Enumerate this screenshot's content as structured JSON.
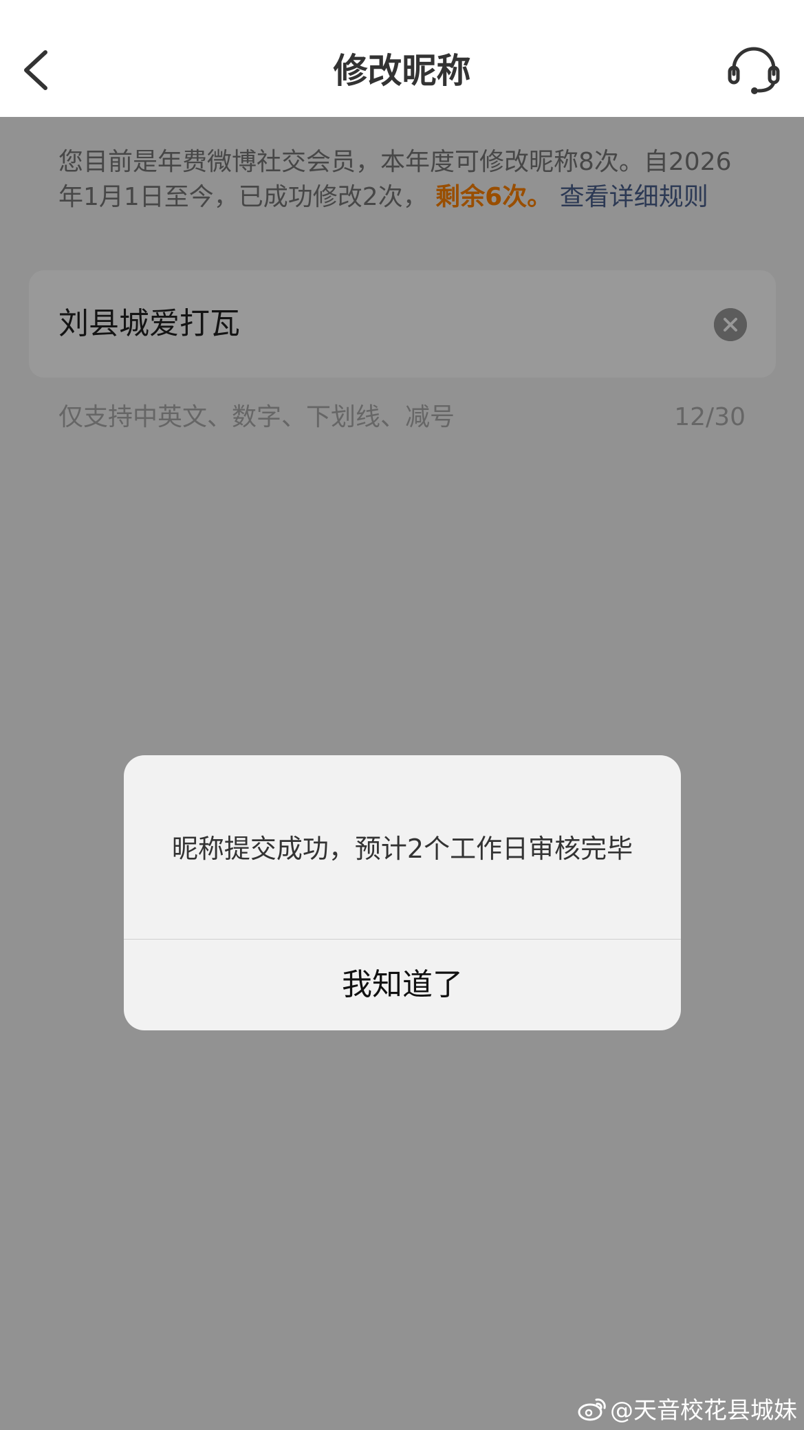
{
  "header": {
    "title": "修改昵称",
    "back_icon": "chevron-left-icon",
    "service_icon": "headset-icon"
  },
  "notice": {
    "text_part1": "您目前是年费微博社交会员，本年度可修改昵称8次。自2026年1月1日至今，已成功修改2次，",
    "remaining": "剩余6次。",
    "rules_link": "查看详细规则",
    "remaining_color": "#ff8200",
    "link_color": "#4a5f8c"
  },
  "nickname_input": {
    "value": "刘县城爱打瓦",
    "clear_icon": "clear-circle-icon"
  },
  "hint": {
    "text": "仅支持中英文、数字、下划线、减号",
    "counter": "12/30"
  },
  "dialog": {
    "message": "昵称提交成功，预计2个工作日审核完毕",
    "confirm_label": "我知道了"
  },
  "watermark": {
    "text": "@天音校花县城妹",
    "logo": "weibo-logo"
  }
}
